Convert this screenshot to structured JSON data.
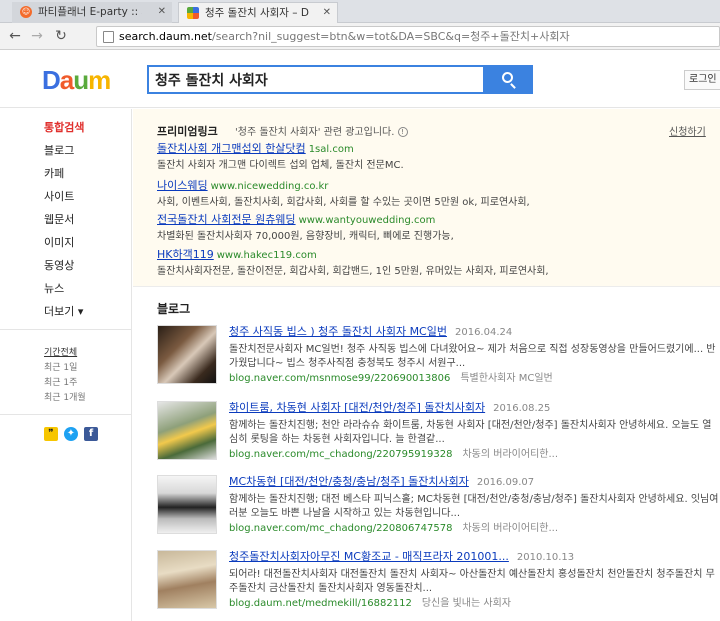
{
  "browser": {
    "tabs": [
      {
        "title": "파티플래너 E-party :: 파",
        "active": false
      },
      {
        "title": "청주 돌잔치 사회자 – Da",
        "active": true
      }
    ],
    "url_host": "search.daum.net",
    "url_rest": "/search?nil_suggest=btn&w=tot&DA=SBC&q=청주+돌잔치+사회자"
  },
  "header": {
    "logo_parts": [
      "D",
      "a",
      "u",
      "m"
    ],
    "search_value": "청주 돌잔치 사회자",
    "login_label": "로그인"
  },
  "sidebar": {
    "nav": [
      "통합검색",
      "블로그",
      "카페",
      "사이트",
      "웹문서",
      "이미지",
      "동영상",
      "뉴스",
      "더보기 ▾"
    ],
    "period": [
      "기간전체",
      "최근 1일",
      "최근 1주",
      "최근 1개월"
    ]
  },
  "premium": {
    "title": "프리미엄링크",
    "desc": "'청주 돌잔치 사회자' 관련 광고입니다.",
    "apply": "신청하기",
    "ads": [
      {
        "title": "돌잔치사회 개그맨섭외 한살닷컴",
        "url": "1sal.com",
        "desc": "돌잔치 사회자 개그맨 다이렉트 섭외 업체, 돌잔치 전문MC."
      },
      {
        "title": "나이스웨딩",
        "url": "www.nicewedding.co.kr",
        "desc": "사회, 이벤트사회, 돌잔치사회, 회갑사회, 사회를 할 수있는 곳이면 5만원 ok, 피로연사회,"
      },
      {
        "title": "전국돌잔치 사회전문 원츄웨딩",
        "url": "www.wantyouwedding.com",
        "desc": "차별화된 돌잔치사회자 70,000원, 음향장비, 캐릭터, 삐에로 진행가능,"
      },
      {
        "title": "HK하객119",
        "url": "www.hakec119.com",
        "desc": "돌잔치사회자전문, 돌잔이전문, 회갑사회, 회갑밴드, 1인 5만원, 유머있는 사회자, 피로연사회,"
      }
    ]
  },
  "blog": {
    "heading": "블로그",
    "posts": [
      {
        "title": "청주 사직동 빕스 ) 청주 돌잔치 사회자 MC일번",
        "date": "2016.04.24",
        "snippet": "돌잔치전문사회자 MC일번! 청주 사직동 빕스에 다녀왔어요~ 제가 처음으로 직접 성장동영상을 만들어드렸기에... 반가웠답니다~ 빕스 청주사직점 충청북도 청주시 서원구...",
        "source": "blog.naver.com/msnmose99/220690013806",
        "author": "특별한사회자 MC일번"
      },
      {
        "title": "화이트룸, 차동현 사회자 [대전/천안/청주] 돌잔치사회자",
        "date": "2016.08.25",
        "snippet": "함께하는 돌잔치진행; 천안 라라슈슈 화이트룸, 차동현 사회자 [대전/천안/청주] 돌잔치사회자 안녕하세요. 오늘도 열심히 롯팅을 하는 차동현 사회자입니다. 늘 한결같...",
        "source": "blog.naver.com/mc_chadong/220795919328",
        "author": "차동의 버라이어티한..."
      },
      {
        "title": "MC차동현 [대전/천안/충청/충남/청주] 돌잔치사회자",
        "date": "2016.09.07",
        "snippet": "함께하는 돌잔치진행; 대전 베스타 피닉스홀; MC차동현 [대전/천안/충청/충남/청주] 돌잔치사회자 안녕하세요. 잇님여러분 오늘도 바쁜 나날을 시작하고 있는 차동현입니다...",
        "source": "blog.naver.com/mc_chadong/220806747578",
        "author": "차동의 버라이어티한..."
      },
      {
        "title": "청주돌잔치사회자아무진 MC황조교 - 매직프라자 201001...",
        "date": "2010.10.13",
        "snippet": "되어라! 대전돌잔치사회자 대전돌잔치 돌잔치 사회자~ 아산돌잔치 예산돌잔치 홍성돌잔치 천안돌잔치 청주돌잔치 무주돌잔치 금산돌잔치 돌잔치사회자 영동돌잔치...",
        "source": "blog.daum.net/medmekill/16882112",
        "author": "당신을 빛내는 사회자"
      }
    ]
  }
}
